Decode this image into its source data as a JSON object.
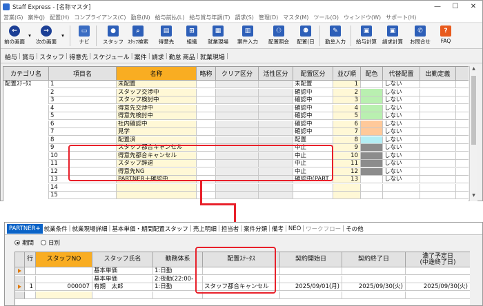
{
  "window": {
    "title": "Staff Express - [名称マスタ]"
  },
  "menu": [
    "営業(G)",
    "案件(J)",
    "配置(H)",
    "コンプライアンス(C)",
    "勤怠(N)",
    "給与前払(L)",
    "給与賞与年調(T)",
    "請求(S)",
    "管理(D)",
    "マスタ(M)",
    "ツール(O)",
    "ウィンドウ(W)",
    "サポート(H)"
  ],
  "toolbar": {
    "prev": "前の画面",
    "next": "次の画面",
    "nav": "ナビ",
    "staff": "スタッフ",
    "staff_search": "ｽﾀｯﾌ検索",
    "tokuisaki": "得意先",
    "soshiki": "組織",
    "shugyo": "就業現場",
    "anken": "案件入力",
    "haichi_shokai": "配置照会",
    "haichi_nichi": "配置(日",
    "kintai": "勤怠入力",
    "kyuyo": "給与計算",
    "seikyu": "請求計算",
    "toiawase": "お問合せ",
    "faq": "FAQ"
  },
  "tabs1": [
    "給与",
    "賞与",
    "スタッフ",
    "得意先",
    "スケジュール",
    "案件",
    "請求",
    "勤怠",
    "商品",
    "就業現場"
  ],
  "grid1": {
    "headers": [
      "カテゴリ名",
      "項目名",
      "名称",
      "略称",
      "クリア区分",
      "活性区分",
      "配置区分",
      "並び順",
      "配色",
      "代替配置",
      "出勤定義"
    ],
    "category": "配置ｽﾃｰﾀｽ",
    "rows": [
      {
        "code": "1",
        "name": "未配置",
        "kubun": "未配置",
        "order": "1",
        "alt": "しない"
      },
      {
        "code": "2",
        "name": "スタッフ交渉中",
        "kubun": "確認中",
        "order": "2",
        "alt": "しない"
      },
      {
        "code": "3",
        "name": "スタッフ検討中",
        "kubun": "確認中",
        "order": "3",
        "alt": "しない"
      },
      {
        "code": "4",
        "name": "得意先交渉中",
        "kubun": "確認中",
        "order": "4",
        "alt": "しない"
      },
      {
        "code": "5",
        "name": "得意先検討中",
        "kubun": "確認中",
        "order": "5",
        "alt": "しない"
      },
      {
        "code": "6",
        "name": "社内確認中",
        "kubun": "確認中",
        "order": "6",
        "alt": "しない"
      },
      {
        "code": "7",
        "name": "見学",
        "kubun": "確認中",
        "order": "7",
        "alt": "しない"
      },
      {
        "code": "8",
        "name": "配置済",
        "kubun": "配置",
        "order": "8",
        "alt": "しない"
      },
      {
        "code": "9",
        "name": "スタッフ都合キャンセル",
        "kubun": "中止",
        "order": "9",
        "alt": "しない"
      },
      {
        "code": "10",
        "name": "得意先都合キャンセル",
        "kubun": "中止",
        "order": "10",
        "alt": "しない"
      },
      {
        "code": "11",
        "name": "スタッフ辞退",
        "kubun": "中止",
        "order": "11",
        "alt": "しない"
      },
      {
        "code": "12",
        "name": "得意先NG",
        "kubun": "中止",
        "order": "12",
        "alt": "しない"
      },
      {
        "code": "13",
        "name": "PARTNER＋確認中",
        "kubun": "確認中(PART",
        "order": "13",
        "alt": "しない"
      },
      {
        "code": "14",
        "name": "",
        "kubun": "",
        "order": "",
        "alt": ""
      },
      {
        "code": "15",
        "name": "",
        "kubun": "",
        "order": "",
        "alt": ""
      }
    ],
    "colors": [
      "#ffffff",
      "#b9f0b0",
      "#b9f0b0",
      "#b9f0b0",
      "#b9f0b0",
      "#ffc99a",
      "#ffc99a",
      "#b3eef5",
      "#8c8c8c",
      "#8c8c8c",
      "#8c8c8c",
      "#8c8c8c",
      "#ffffff",
      "#ffffff",
      "#ffffff"
    ]
  },
  "tabs2": [
    "PARTNER+",
    "就業条件",
    "就業現場詳細",
    "基本単価・期間配置スタッフ",
    "売上明細",
    "担当者",
    "案件分類",
    "備考",
    "NEO",
    "ワークフロー",
    "その他"
  ],
  "period": {
    "kikan": "期間",
    "hibetsu": "日別"
  },
  "grid2": {
    "headers": [
      "行",
      "スタッフNO",
      "スタッフ氏名",
      "勤務体系",
      "配置ｽﾃｰﾀｽ",
      "契約開始日",
      "契約終了日",
      "満了予定日\n(中途終了日)"
    ],
    "rows": [
      {
        "no": "",
        "staffno": "",
        "name": "基本単価",
        "kinmu": "1:日勤",
        "status": "",
        "start": "",
        "end": "",
        "expire": ""
      },
      {
        "no": "",
        "staffno": "",
        "name": "基本単価",
        "kinmu": "2:夜勤(22:00-",
        "status": "",
        "start": "",
        "end": "",
        "expire": ""
      },
      {
        "no": "1",
        "staffno": "000007",
        "name": "有期　太郎",
        "kinmu": "1:日勤",
        "status": "スタッフ都合キャンセル",
        "start": "2025/09/01(月)",
        "end": "2025/09/30(火)",
        "expire": "2025/09/30(火)"
      },
      {
        "no": "",
        "staffno": "",
        "name": "",
        "kinmu": "",
        "status": "",
        "start": "",
        "end": "",
        "expire": ""
      }
    ]
  }
}
